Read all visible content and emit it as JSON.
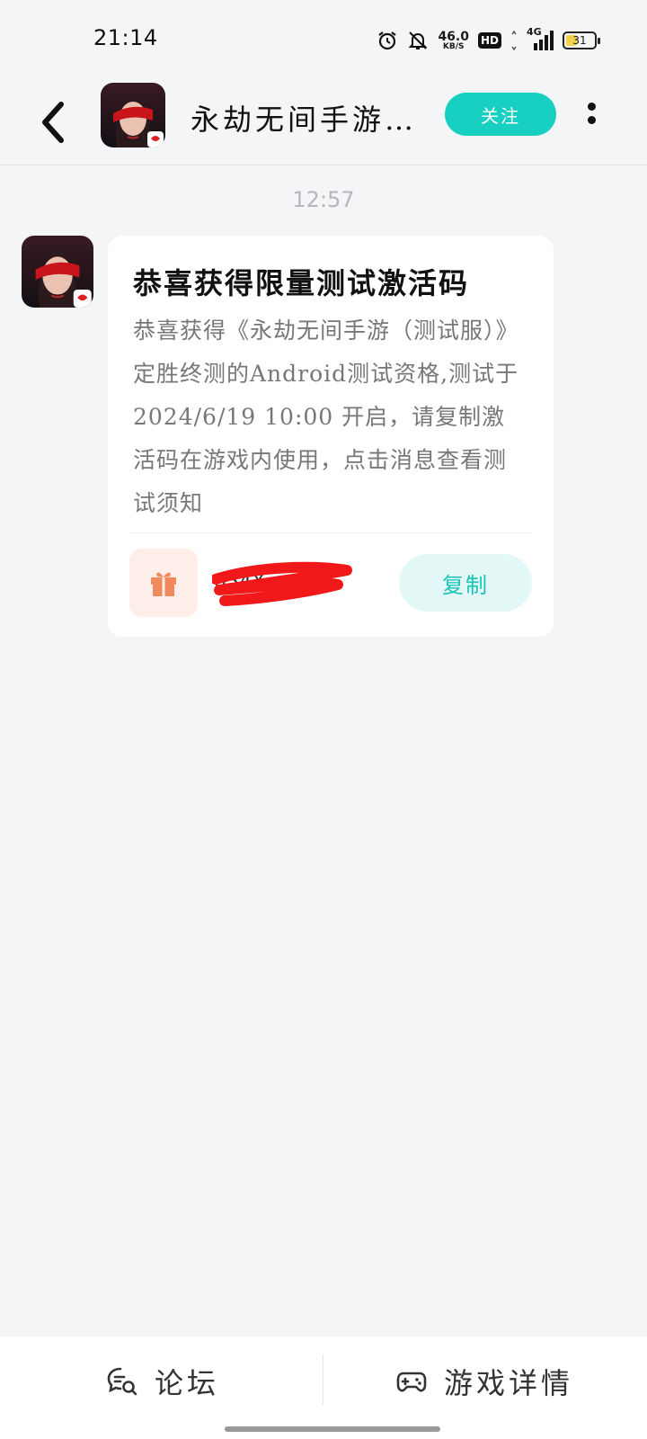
{
  "status_bar": {
    "time": "21:14",
    "net_speed": "46.0",
    "net_unit": "KB/S",
    "hd": "HD",
    "network": "4G",
    "battery": "31",
    "icons": [
      "alarm-icon",
      "bell-mute-icon",
      "signal-icon",
      "battery-icon"
    ]
  },
  "header": {
    "title": "永劫无间手游…",
    "follow_label": "关注",
    "back_icon": "chevron-left-icon",
    "more_icon": "more-vertical-icon"
  },
  "chat": {
    "timestamp": "12:57",
    "message": {
      "title": "恭喜获得限量测试激活码",
      "body": "恭喜获得《永劫无间手游（测试服）》定胜终测的Android测试资格,测试于 2024/6/19 10:00 开启，请复制激活码在游戏内使用，点击消息查看测试须知",
      "gift_icon": "gift-icon",
      "copy_label": "复制"
    }
  },
  "bottom_nav": {
    "forum_label": "论坛",
    "detail_label": "游戏详情"
  },
  "colors": {
    "accent": "#17d0c2",
    "gift_bg": "#fdeee9",
    "gift_icon": "#f08a5d",
    "redaction": "#f01818"
  }
}
